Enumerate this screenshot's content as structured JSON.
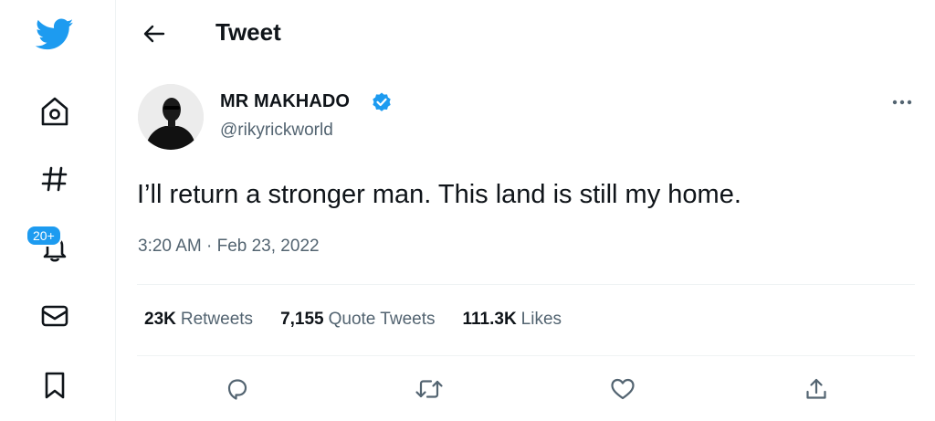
{
  "colors": {
    "brand": "#1d9bf0",
    "text_primary": "#0f1419",
    "text_secondary": "#536471",
    "divider": "#eff3f4"
  },
  "sidebar": {
    "items": [
      {
        "icon": "twitter-logo-icon"
      },
      {
        "icon": "home-icon"
      },
      {
        "icon": "hashtag-explore-icon"
      },
      {
        "icon": "bell-notifications-icon",
        "badge": "20+"
      },
      {
        "icon": "envelope-messages-icon"
      },
      {
        "icon": "bookmark-icon"
      }
    ]
  },
  "header": {
    "title": "Tweet",
    "back_icon": "arrow-left-icon"
  },
  "tweet": {
    "author_name": "MR MAKHADO",
    "handle": "@rikyrickworld",
    "verified": true,
    "text": "I’ll return a stronger man. This land is still my home.",
    "time": "3:20 AM · Feb 23, 2022"
  },
  "stats": [
    {
      "count": "23K",
      "label": "Retweets"
    },
    {
      "count": "7,155",
      "label": "Quote Tweets"
    },
    {
      "count": "111.3K",
      "label": "Likes"
    }
  ],
  "actions": [
    {
      "icon": "reply-icon"
    },
    {
      "icon": "retweet-icon"
    },
    {
      "icon": "like-heart-icon"
    },
    {
      "icon": "share-icon"
    }
  ]
}
